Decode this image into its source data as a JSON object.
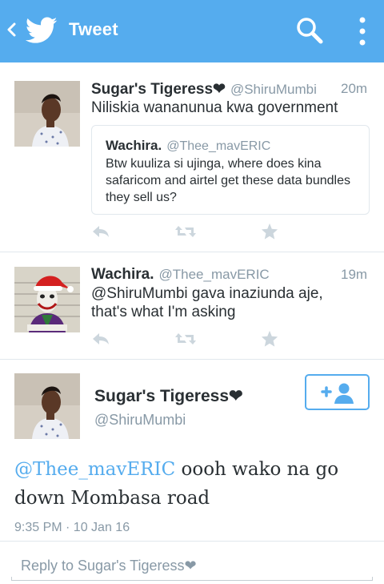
{
  "app_bar": {
    "title": "Tweet",
    "color": "#55acee",
    "icons": [
      "back-chevron-icon",
      "twitter-bird-icon",
      "search-icon",
      "overflow-menu-icon"
    ]
  },
  "tweets": [
    {
      "name": "Sugar's Tigeress❤",
      "handle": "@ShiruMumbi",
      "time": "20m",
      "text": "Niliskia wananunua kwa government",
      "quoted": {
        "name": "Wachira.",
        "handle": "@Thee_mavERIC",
        "text": "Btw kuuliza si ujinga, where does kina safaricom and airtel get these data bundles they sell us?"
      }
    },
    {
      "name": "Wachira.",
      "handle": "@Thee_mavERIC",
      "time": "19m",
      "text": "@ShiruMumbi gava inaziunda aje, that's what I'm asking"
    }
  ],
  "detail": {
    "name": "Sugar's Tigeress❤",
    "handle": "@ShiruMumbi",
    "mention": "@Thee_mavERIC",
    "text_rest": " oooh wako na go down Mombasa road",
    "timestamp": "9:35 PM · 10 Jan 16",
    "follow_icon": "add-user-icon"
  },
  "reply": {
    "placeholder": "Reply to Sugar's Tigeress❤"
  }
}
